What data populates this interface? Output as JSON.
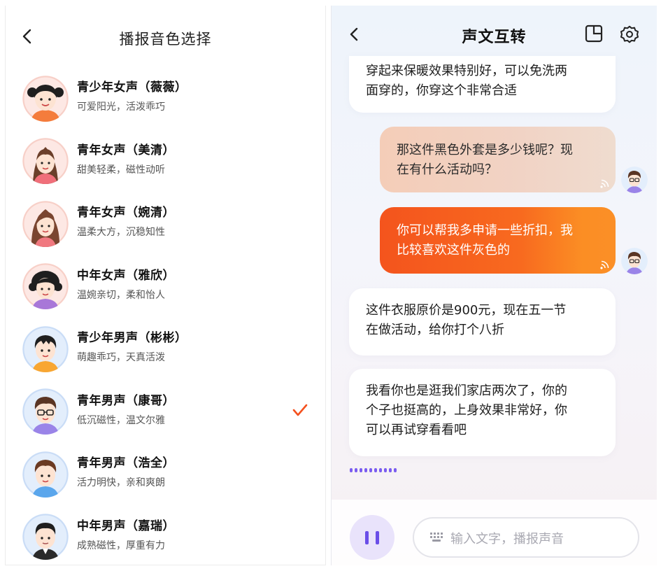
{
  "left_panel": {
    "title": "播报音色选择",
    "voices": [
      {
        "name": "青少年女声（薇薇）",
        "desc": "可爱阳光，活泼乖巧",
        "selected": false,
        "icon": "teen-girl-avatar"
      },
      {
        "name": "青年女声（美清）",
        "desc": "甜美轻柔，磁性动听",
        "selected": false,
        "icon": "young-woman-avatar"
      },
      {
        "name": "青年女声（婉清）",
        "desc": "温柔大方，沉稳知性",
        "selected": false,
        "icon": "young-woman-long-hair-avatar"
      },
      {
        "name": "中年女声（雅欣）",
        "desc": "温婉亲切，柔和怡人",
        "selected": false,
        "icon": "middle-aged-woman-avatar"
      },
      {
        "name": "青少年男声（彬彬）",
        "desc": "萌趣乖巧，天真活泼",
        "selected": false,
        "icon": "teen-boy-avatar"
      },
      {
        "name": "青年男声（康哥）",
        "desc": "低沉磁性，温文尔雅",
        "selected": true,
        "icon": "young-man-glasses-avatar"
      },
      {
        "name": "青年男声（浩全）",
        "desc": "活力明快，亲和爽朗",
        "selected": false,
        "icon": "young-man-avatar"
      },
      {
        "name": "中年男声（嘉瑞）",
        "desc": "成熟磁性，厚重有力",
        "selected": false,
        "icon": "middle-aged-man-avatar"
      }
    ],
    "check_color": "#f4511e"
  },
  "right_panel": {
    "title": "声文互转",
    "messages": [
      {
        "side": "in",
        "text_lines": [
          "穿起来保暖效果特别好，可以免洗两",
          "面穿的，你穿这个非常合适"
        ]
      },
      {
        "side": "out",
        "text_lines": [
          "那这件黑色外套是多少钱呢？现",
          "在有什么活动吗？"
        ]
      },
      {
        "side": "out",
        "text_lines": [
          "你可以帮我多申请一些折扣，我",
          "比较喜欢这件灰色的"
        ]
      },
      {
        "side": "in",
        "text_lines": [
          "这件衣服原价是900元，现在五一节",
          "在做活动，给你打个八折"
        ]
      },
      {
        "side": "in",
        "text_lines": [
          "我看你也是逛我们家店两次了，你的",
          "个子也挺高的，上身效果非常好，你",
          "可以再试穿看看吧"
        ]
      }
    ],
    "input_placeholder": "输入文字，播报声音",
    "accent": "#6a4ee8",
    "out_accent": "#f4541d"
  }
}
